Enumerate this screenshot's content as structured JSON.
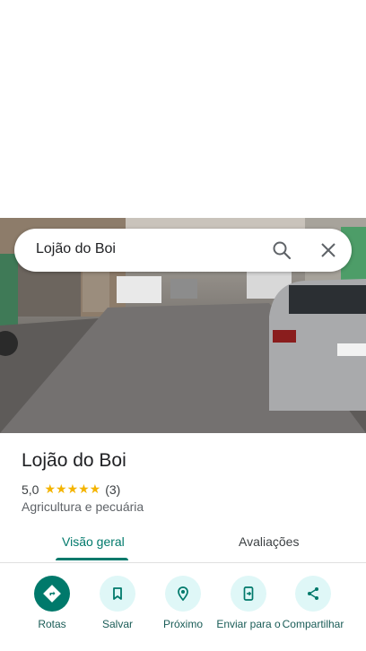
{
  "search": {
    "query": "Lojão do Boi"
  },
  "place": {
    "name": "Lojão do Boi",
    "rating": "5,0",
    "stars": "★★★★★",
    "review_count": "(3)",
    "category": "Agricultura e pecuária"
  },
  "tabs": [
    {
      "label": "Visão geral",
      "active": true
    },
    {
      "label": "Avaliações",
      "active": false
    }
  ],
  "actions": [
    {
      "label": "Rotas",
      "icon": "directions-icon"
    },
    {
      "label": "Salvar",
      "icon": "bookmark-icon"
    },
    {
      "label": "Próximo",
      "icon": "nearby-icon"
    },
    {
      "label": "Enviar para o",
      "icon": "send-to-phone-icon"
    },
    {
      "label": "Compartilhar",
      "icon": "share-icon"
    }
  ],
  "colors": {
    "accent": "#00796b",
    "action_bg": "#dff7f7",
    "star": "#f4b400"
  }
}
